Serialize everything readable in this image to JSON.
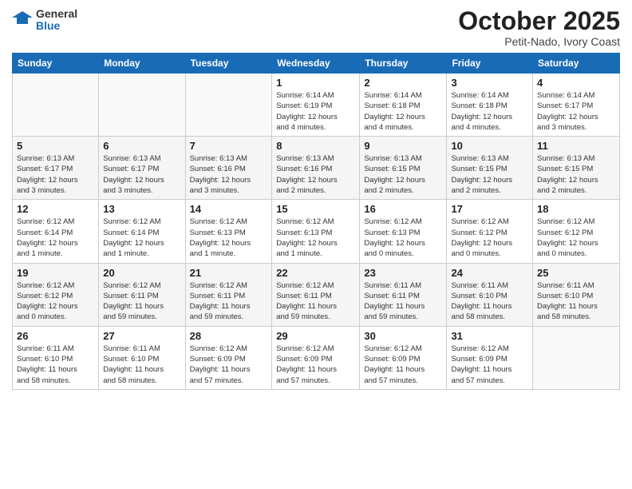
{
  "logo": {
    "text_general": "General",
    "text_blue": "Blue"
  },
  "header": {
    "month": "October 2025",
    "location": "Petit-Nado, Ivory Coast"
  },
  "weekdays": [
    "Sunday",
    "Monday",
    "Tuesday",
    "Wednesday",
    "Thursday",
    "Friday",
    "Saturday"
  ],
  "weeks": [
    [
      {
        "day": "",
        "info": ""
      },
      {
        "day": "",
        "info": ""
      },
      {
        "day": "",
        "info": ""
      },
      {
        "day": "1",
        "info": "Sunrise: 6:14 AM\nSunset: 6:19 PM\nDaylight: 12 hours\nand 4 minutes."
      },
      {
        "day": "2",
        "info": "Sunrise: 6:14 AM\nSunset: 6:18 PM\nDaylight: 12 hours\nand 4 minutes."
      },
      {
        "day": "3",
        "info": "Sunrise: 6:14 AM\nSunset: 6:18 PM\nDaylight: 12 hours\nand 4 minutes."
      },
      {
        "day": "4",
        "info": "Sunrise: 6:14 AM\nSunset: 6:17 PM\nDaylight: 12 hours\nand 3 minutes."
      }
    ],
    [
      {
        "day": "5",
        "info": "Sunrise: 6:13 AM\nSunset: 6:17 PM\nDaylight: 12 hours\nand 3 minutes."
      },
      {
        "day": "6",
        "info": "Sunrise: 6:13 AM\nSunset: 6:17 PM\nDaylight: 12 hours\nand 3 minutes."
      },
      {
        "day": "7",
        "info": "Sunrise: 6:13 AM\nSunset: 6:16 PM\nDaylight: 12 hours\nand 3 minutes."
      },
      {
        "day": "8",
        "info": "Sunrise: 6:13 AM\nSunset: 6:16 PM\nDaylight: 12 hours\nand 2 minutes."
      },
      {
        "day": "9",
        "info": "Sunrise: 6:13 AM\nSunset: 6:15 PM\nDaylight: 12 hours\nand 2 minutes."
      },
      {
        "day": "10",
        "info": "Sunrise: 6:13 AM\nSunset: 6:15 PM\nDaylight: 12 hours\nand 2 minutes."
      },
      {
        "day": "11",
        "info": "Sunrise: 6:13 AM\nSunset: 6:15 PM\nDaylight: 12 hours\nand 2 minutes."
      }
    ],
    [
      {
        "day": "12",
        "info": "Sunrise: 6:12 AM\nSunset: 6:14 PM\nDaylight: 12 hours\nand 1 minute."
      },
      {
        "day": "13",
        "info": "Sunrise: 6:12 AM\nSunset: 6:14 PM\nDaylight: 12 hours\nand 1 minute."
      },
      {
        "day": "14",
        "info": "Sunrise: 6:12 AM\nSunset: 6:13 PM\nDaylight: 12 hours\nand 1 minute."
      },
      {
        "day": "15",
        "info": "Sunrise: 6:12 AM\nSunset: 6:13 PM\nDaylight: 12 hours\nand 1 minute."
      },
      {
        "day": "16",
        "info": "Sunrise: 6:12 AM\nSunset: 6:13 PM\nDaylight: 12 hours\nand 0 minutes."
      },
      {
        "day": "17",
        "info": "Sunrise: 6:12 AM\nSunset: 6:12 PM\nDaylight: 12 hours\nand 0 minutes."
      },
      {
        "day": "18",
        "info": "Sunrise: 6:12 AM\nSunset: 6:12 PM\nDaylight: 12 hours\nand 0 minutes."
      }
    ],
    [
      {
        "day": "19",
        "info": "Sunrise: 6:12 AM\nSunset: 6:12 PM\nDaylight: 12 hours\nand 0 minutes."
      },
      {
        "day": "20",
        "info": "Sunrise: 6:12 AM\nSunset: 6:11 PM\nDaylight: 11 hours\nand 59 minutes."
      },
      {
        "day": "21",
        "info": "Sunrise: 6:12 AM\nSunset: 6:11 PM\nDaylight: 11 hours\nand 59 minutes."
      },
      {
        "day": "22",
        "info": "Sunrise: 6:12 AM\nSunset: 6:11 PM\nDaylight: 11 hours\nand 59 minutes."
      },
      {
        "day": "23",
        "info": "Sunrise: 6:11 AM\nSunset: 6:11 PM\nDaylight: 11 hours\nand 59 minutes."
      },
      {
        "day": "24",
        "info": "Sunrise: 6:11 AM\nSunset: 6:10 PM\nDaylight: 11 hours\nand 58 minutes."
      },
      {
        "day": "25",
        "info": "Sunrise: 6:11 AM\nSunset: 6:10 PM\nDaylight: 11 hours\nand 58 minutes."
      }
    ],
    [
      {
        "day": "26",
        "info": "Sunrise: 6:11 AM\nSunset: 6:10 PM\nDaylight: 11 hours\nand 58 minutes."
      },
      {
        "day": "27",
        "info": "Sunrise: 6:11 AM\nSunset: 6:10 PM\nDaylight: 11 hours\nand 58 minutes."
      },
      {
        "day": "28",
        "info": "Sunrise: 6:12 AM\nSunset: 6:09 PM\nDaylight: 11 hours\nand 57 minutes."
      },
      {
        "day": "29",
        "info": "Sunrise: 6:12 AM\nSunset: 6:09 PM\nDaylight: 11 hours\nand 57 minutes."
      },
      {
        "day": "30",
        "info": "Sunrise: 6:12 AM\nSunset: 6:09 PM\nDaylight: 11 hours\nand 57 minutes."
      },
      {
        "day": "31",
        "info": "Sunrise: 6:12 AM\nSunset: 6:09 PM\nDaylight: 11 hours\nand 57 minutes."
      },
      {
        "day": "",
        "info": ""
      }
    ]
  ]
}
